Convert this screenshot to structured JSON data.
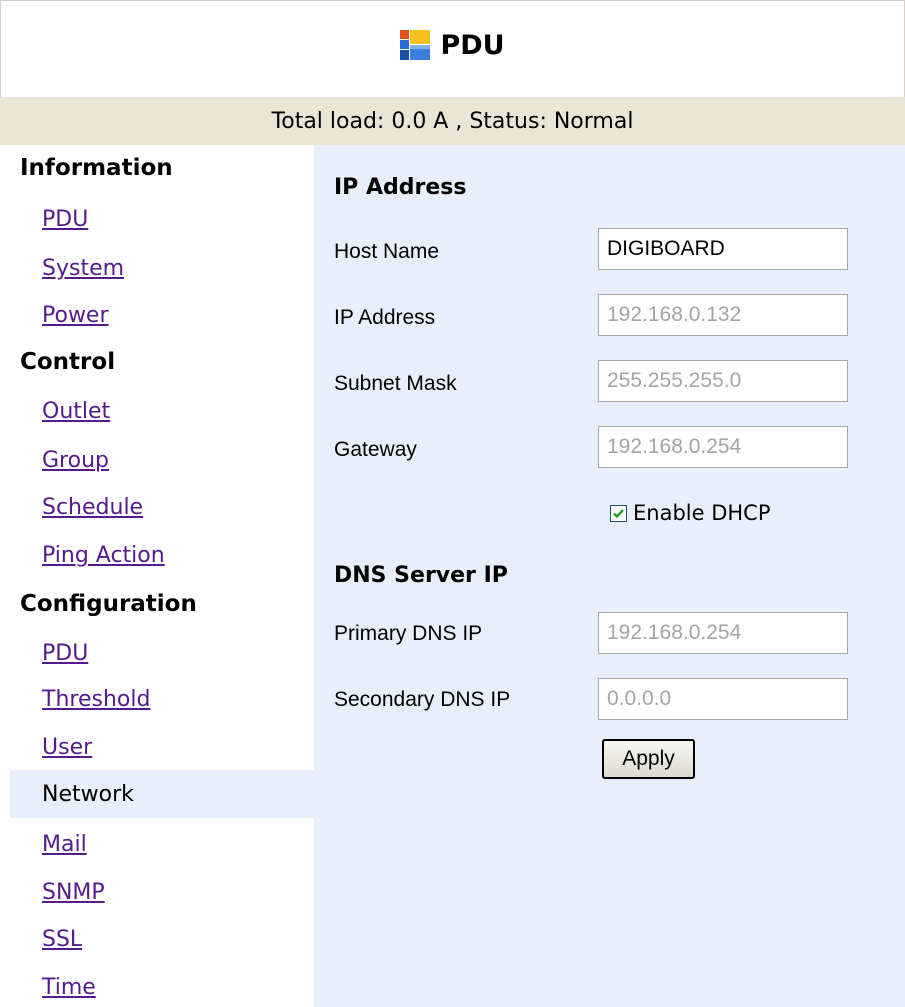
{
  "header": {
    "title": "PDU",
    "logo_icon": "pdu-logo-icon"
  },
  "status_bar": {
    "text": "Total load: 0.0 A , Status: Normal"
  },
  "sidebar": {
    "sections": [
      {
        "label": "Information",
        "items": [
          "PDU",
          "System",
          "Power"
        ]
      },
      {
        "label": "Control",
        "items": [
          "Outlet",
          "Group",
          "Schedule",
          "Ping Action"
        ]
      },
      {
        "label": "Configuration",
        "items": [
          "PDU",
          "Threshold",
          "User",
          "Network",
          "Mail",
          "SNMP",
          "SSL",
          "Time"
        ]
      }
    ],
    "active_item": "Network"
  },
  "main": {
    "ip_heading": "IP Address",
    "host_name": {
      "label": "Host Name",
      "value": "DIGIBOARD"
    },
    "ip_address": {
      "label": "IP Address",
      "value": "192.168.0.132"
    },
    "subnet_mask": {
      "label": "Subnet Mask",
      "value": "255.255.255.0"
    },
    "gateway": {
      "label": "Gateway",
      "value": "192.168.0.254"
    },
    "dhcp": {
      "label": "Enable DHCP",
      "checked": true
    },
    "dns_heading": "DNS Server IP",
    "primary_dns": {
      "label": "Primary DNS IP",
      "value": "192.168.0.254"
    },
    "secondary_dns": {
      "label": "Secondary DNS IP",
      "value": "0.0.0.0"
    },
    "apply_label": "Apply"
  },
  "colors": {
    "status_bar_bg": "#eae6d5",
    "content_bg": "#e8eefa",
    "link": "#551a8b",
    "disabled_text": "#a4a4a4",
    "checkmark": "#21a121"
  }
}
